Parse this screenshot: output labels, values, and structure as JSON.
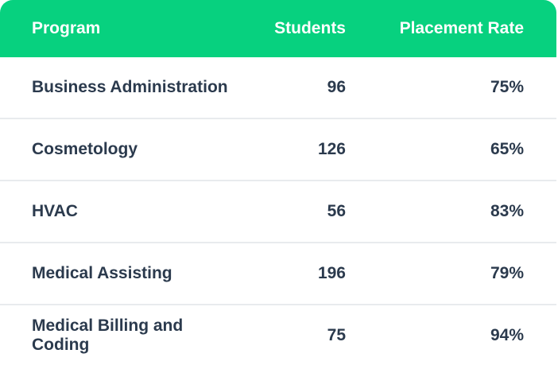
{
  "table": {
    "columns": [
      "Program",
      "Students",
      "Placement Rate"
    ],
    "rows": [
      {
        "program": "Business Administration",
        "students": "96",
        "rate": "75%"
      },
      {
        "program": "Cosmetology",
        "students": "126",
        "rate": "65%"
      },
      {
        "program": "HVAC",
        "students": "56",
        "rate": "83%"
      },
      {
        "program": "Medical Assisting",
        "students": "196",
        "rate": "79%"
      },
      {
        "program": "Medical Billing and Coding",
        "students": "75",
        "rate": "94%"
      }
    ]
  },
  "colors": {
    "header_bg": "#07d17f",
    "header_text": "#ffffff",
    "body_text": "#2b3a4d",
    "divider": "#e8ebee"
  }
}
